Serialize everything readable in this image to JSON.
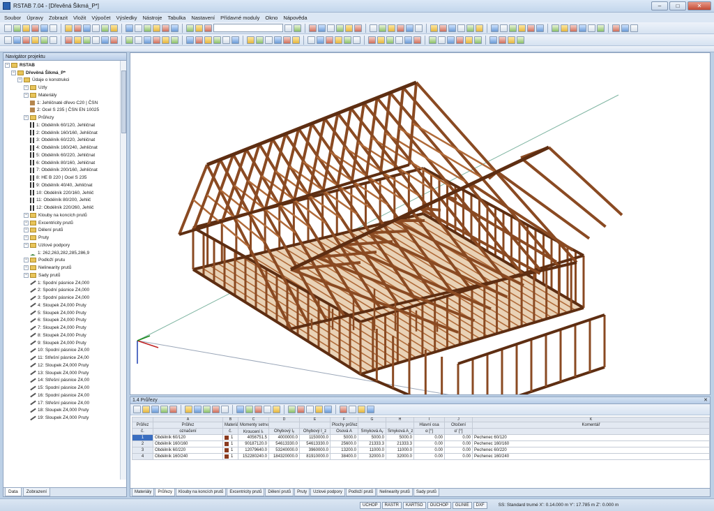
{
  "window": {
    "title": "RSTAB 7.04 - [Dřevěná Šikmá_P*]"
  },
  "menu": [
    "Soubor",
    "Úpravy",
    "Zobrazit",
    "Vložit",
    "Výpočet",
    "Výsledky",
    "Nástroje",
    "Tabulka",
    "Nastavení",
    "Přídavné moduly",
    "Okno",
    "Nápověda"
  ],
  "navigator": {
    "title": "Navigátor projektu",
    "items": [
      {
        "level": 0,
        "label": "RSTAB",
        "icon": "app"
      },
      {
        "level": 1,
        "label": "Dřevěná Šikmá_P*",
        "icon": "model"
      },
      {
        "level": 2,
        "label": "Údaje o konstrukci",
        "icon": "folder"
      },
      {
        "level": 3,
        "label": "Uzly",
        "icon": "folder"
      },
      {
        "level": 3,
        "label": "Materiály",
        "icon": "folder"
      },
      {
        "level": 4,
        "label": "1: Jehličnaté dřevo C20 | ČSN",
        "icon": "material"
      },
      {
        "level": 4,
        "label": "2: Ocel S 235 | ČSN EN 10025",
        "icon": "material"
      },
      {
        "level": 3,
        "label": "Průřezy",
        "icon": "folder"
      },
      {
        "level": 4,
        "label": "1: Obdélník 60/120, Jehličnat",
        "icon": "section"
      },
      {
        "level": 4,
        "label": "2: Obdélník 160/160, Jehličnat",
        "icon": "section"
      },
      {
        "level": 4,
        "label": "3: Obdélník 60/220, Jehličnat",
        "icon": "section"
      },
      {
        "level": 4,
        "label": "4: Obdélník 160/240, Jehličnat",
        "icon": "section"
      },
      {
        "level": 4,
        "label": "5: Obdélník 60/220, Jehličnat",
        "icon": "section"
      },
      {
        "level": 4,
        "label": "6: Obdélník 80/160, Jehličnat",
        "icon": "section"
      },
      {
        "level": 4,
        "label": "7: Obdélník 200/160, Jehličnat",
        "icon": "section"
      },
      {
        "level": 4,
        "label": "8: HE B 220 | Ocel S 235",
        "icon": "section"
      },
      {
        "level": 4,
        "label": "9: Obdélník 40/40, Jehličnat",
        "icon": "section"
      },
      {
        "level": 4,
        "label": "10: Obdélník 220/160, Jehlič",
        "icon": "section"
      },
      {
        "level": 4,
        "label": "11: Obdélník 80/200, Jehlič",
        "icon": "section"
      },
      {
        "level": 4,
        "label": "12: Obdélník 220/260, Jehlič",
        "icon": "section"
      },
      {
        "level": 3,
        "label": "Klouby na koncích prutů",
        "icon": "folder"
      },
      {
        "level": 3,
        "label": "Excentricity prutů",
        "icon": "folder"
      },
      {
        "level": 3,
        "label": "Dělení prutů",
        "icon": "folder"
      },
      {
        "level": 3,
        "label": "Pruty",
        "icon": "folder"
      },
      {
        "level": 3,
        "label": "Uzlové podpory",
        "icon": "folder"
      },
      {
        "level": 4,
        "label": "1: 262,263,282,285,286,9",
        "icon": "support"
      },
      {
        "level": 3,
        "label": "Podloží prutu",
        "icon": "folder"
      },
      {
        "level": 3,
        "label": "Nelinearity prutů",
        "icon": "folder"
      },
      {
        "level": 3,
        "label": "Sady prutů",
        "icon": "folder"
      },
      {
        "level": 4,
        "label": "1: Spodní pásnice Z4,000",
        "icon": "set"
      },
      {
        "level": 4,
        "label": "2: Spodní pásnice Z4,000",
        "icon": "set"
      },
      {
        "level": 4,
        "label": "3: Spodní pásnice Z4,000",
        "icon": "set"
      },
      {
        "level": 4,
        "label": "4: Sloupek Z4,000 Pruty",
        "icon": "set"
      },
      {
        "level": 4,
        "label": "5: Sloupek Z4,000 Pruty",
        "icon": "set"
      },
      {
        "level": 4,
        "label": "6: Sloupek Z4,000 Pruty",
        "icon": "set"
      },
      {
        "level": 4,
        "label": "7: Sloupek Z4,000 Pruty",
        "icon": "set"
      },
      {
        "level": 4,
        "label": "8: Sloupek Z4,000 Pruty",
        "icon": "set"
      },
      {
        "level": 4,
        "label": "9: Sloupek Z4,000 Pruty",
        "icon": "set"
      },
      {
        "level": 4,
        "label": "10: Spodní pásnice Z4,00",
        "icon": "set"
      },
      {
        "level": 4,
        "label": "11: Střešní pásnice Z4,00",
        "icon": "set"
      },
      {
        "level": 4,
        "label": "12: Sloupek Z4,000 Pruty",
        "icon": "set"
      },
      {
        "level": 4,
        "label": "13: Sloupek Z4,000 Pruty",
        "icon": "set"
      },
      {
        "level": 4,
        "label": "14: Střešní pásnice Z4,00",
        "icon": "set"
      },
      {
        "level": 4,
        "label": "15: Spodní pásnice Z4,00",
        "icon": "set"
      },
      {
        "level": 4,
        "label": "16: Spodní pásnice Z4,00",
        "icon": "set"
      },
      {
        "level": 4,
        "label": "17: Střešní pásnice Z4,00",
        "icon": "set"
      },
      {
        "level": 4,
        "label": "18: Sloupek Z4,000 Pruty",
        "icon": "set"
      },
      {
        "level": 4,
        "label": "19: Sloupek Z4,000 Pruty",
        "icon": "set"
      }
    ],
    "tabs": [
      "Data",
      "Zobrazení"
    ]
  },
  "panel": {
    "title": "1.4 Průřezy",
    "letters": [
      "",
      "A",
      "B",
      "C",
      "D",
      "E",
      "F",
      "G",
      "H",
      "I",
      "J",
      "K"
    ],
    "head1": [
      "Průřez",
      "Průřez",
      "Materiál",
      "Momenty setrvačnosti [mm⁴]",
      "",
      "",
      "Plochy průřezu [mm²]",
      "",
      "",
      "Hlavní osa",
      "Otočení",
      "Komentář"
    ],
    "head2": [
      "č.",
      "označení",
      "č.",
      "Kroucení Iₜ",
      "Ohybový Iᵧ",
      "Ohybový I_z",
      "Osová A",
      "Smyková Aᵧ",
      "Smyková A_z",
      "α [°]",
      "α' [°]",
      ""
    ],
    "rows": [
      [
        "1",
        "Obdélník 60/120",
        "1",
        "4056751.5",
        "4000000.0",
        "1150000.0",
        "5000.0",
        "5000.0",
        "5000.0",
        "0.00",
        "0.00",
        "Pechenec 60/120"
      ],
      [
        "2",
        "Obdélník 160/160",
        "1",
        "90187120.0",
        "54613330.0",
        "54613330.0",
        "25600.0",
        "21333.3",
        "21333.3",
        "0.00",
        "0.00",
        "Pechenec 160/160"
      ],
      [
        "3",
        "Obdélník 60/220",
        "1",
        "12079640.0",
        "53240000.0",
        "3960000.0",
        "13200.0",
        "11000.0",
        "11000.0",
        "0.00",
        "0.00",
        "Pechenec 60/220"
      ],
      [
        "4",
        "Obdélník 160/240",
        "1",
        "152280240.0",
        "184320000.0",
        "81910000.0",
        "38400.0",
        "32000.0",
        "32000.0",
        "0.00",
        "0.00",
        "Pechenec 160/240"
      ]
    ],
    "swatch_color": "#8a3a1e",
    "tabs": [
      "Materiály",
      "Průřezy",
      "Klouby na koncích prutů",
      "Excentricity prutů",
      "Dělení prutů",
      "Pruty",
      "Uzlové podpory",
      "Podloží prutů",
      "Nelinearity prutů",
      "Sady prutů"
    ]
  },
  "status": {
    "buttons": [
      "UCHOP",
      "RASTR",
      "KARTSO",
      "OUCHOP",
      "GLINIE",
      "DXF"
    ],
    "info": "SS: Standard trumé  X': 0.14.000 m   Y': 17.785 m   Z': 0.000 m"
  },
  "colors": {
    "timber": "#8a4a22",
    "timber_light": "#b06a38",
    "timber_dark": "#5e2e12",
    "axis_line": "#7fb5a2"
  }
}
